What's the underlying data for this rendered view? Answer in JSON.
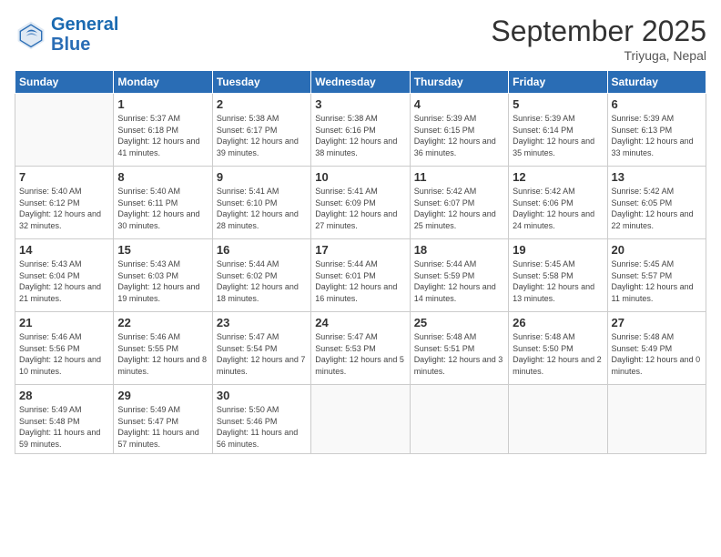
{
  "header": {
    "logo_text_general": "General",
    "logo_text_blue": "Blue",
    "month_title": "September 2025",
    "location": "Triyuga, Nepal"
  },
  "days_of_week": [
    "Sunday",
    "Monday",
    "Tuesday",
    "Wednesday",
    "Thursday",
    "Friday",
    "Saturday"
  ],
  "weeks": [
    [
      {
        "day": "",
        "sunrise": "",
        "sunset": "",
        "daylight": ""
      },
      {
        "day": "1",
        "sunrise": "Sunrise: 5:37 AM",
        "sunset": "Sunset: 6:18 PM",
        "daylight": "Daylight: 12 hours and 41 minutes."
      },
      {
        "day": "2",
        "sunrise": "Sunrise: 5:38 AM",
        "sunset": "Sunset: 6:17 PM",
        "daylight": "Daylight: 12 hours and 39 minutes."
      },
      {
        "day": "3",
        "sunrise": "Sunrise: 5:38 AM",
        "sunset": "Sunset: 6:16 PM",
        "daylight": "Daylight: 12 hours and 38 minutes."
      },
      {
        "day": "4",
        "sunrise": "Sunrise: 5:39 AM",
        "sunset": "Sunset: 6:15 PM",
        "daylight": "Daylight: 12 hours and 36 minutes."
      },
      {
        "day": "5",
        "sunrise": "Sunrise: 5:39 AM",
        "sunset": "Sunset: 6:14 PM",
        "daylight": "Daylight: 12 hours and 35 minutes."
      },
      {
        "day": "6",
        "sunrise": "Sunrise: 5:39 AM",
        "sunset": "Sunset: 6:13 PM",
        "daylight": "Daylight: 12 hours and 33 minutes."
      }
    ],
    [
      {
        "day": "7",
        "sunrise": "Sunrise: 5:40 AM",
        "sunset": "Sunset: 6:12 PM",
        "daylight": "Daylight: 12 hours and 32 minutes."
      },
      {
        "day": "8",
        "sunrise": "Sunrise: 5:40 AM",
        "sunset": "Sunset: 6:11 PM",
        "daylight": "Daylight: 12 hours and 30 minutes."
      },
      {
        "day": "9",
        "sunrise": "Sunrise: 5:41 AM",
        "sunset": "Sunset: 6:10 PM",
        "daylight": "Daylight: 12 hours and 28 minutes."
      },
      {
        "day": "10",
        "sunrise": "Sunrise: 5:41 AM",
        "sunset": "Sunset: 6:09 PM",
        "daylight": "Daylight: 12 hours and 27 minutes."
      },
      {
        "day": "11",
        "sunrise": "Sunrise: 5:42 AM",
        "sunset": "Sunset: 6:07 PM",
        "daylight": "Daylight: 12 hours and 25 minutes."
      },
      {
        "day": "12",
        "sunrise": "Sunrise: 5:42 AM",
        "sunset": "Sunset: 6:06 PM",
        "daylight": "Daylight: 12 hours and 24 minutes."
      },
      {
        "day": "13",
        "sunrise": "Sunrise: 5:42 AM",
        "sunset": "Sunset: 6:05 PM",
        "daylight": "Daylight: 12 hours and 22 minutes."
      }
    ],
    [
      {
        "day": "14",
        "sunrise": "Sunrise: 5:43 AM",
        "sunset": "Sunset: 6:04 PM",
        "daylight": "Daylight: 12 hours and 21 minutes."
      },
      {
        "day": "15",
        "sunrise": "Sunrise: 5:43 AM",
        "sunset": "Sunset: 6:03 PM",
        "daylight": "Daylight: 12 hours and 19 minutes."
      },
      {
        "day": "16",
        "sunrise": "Sunrise: 5:44 AM",
        "sunset": "Sunset: 6:02 PM",
        "daylight": "Daylight: 12 hours and 18 minutes."
      },
      {
        "day": "17",
        "sunrise": "Sunrise: 5:44 AM",
        "sunset": "Sunset: 6:01 PM",
        "daylight": "Daylight: 12 hours and 16 minutes."
      },
      {
        "day": "18",
        "sunrise": "Sunrise: 5:44 AM",
        "sunset": "Sunset: 5:59 PM",
        "daylight": "Daylight: 12 hours and 14 minutes."
      },
      {
        "day": "19",
        "sunrise": "Sunrise: 5:45 AM",
        "sunset": "Sunset: 5:58 PM",
        "daylight": "Daylight: 12 hours and 13 minutes."
      },
      {
        "day": "20",
        "sunrise": "Sunrise: 5:45 AM",
        "sunset": "Sunset: 5:57 PM",
        "daylight": "Daylight: 12 hours and 11 minutes."
      }
    ],
    [
      {
        "day": "21",
        "sunrise": "Sunrise: 5:46 AM",
        "sunset": "Sunset: 5:56 PM",
        "daylight": "Daylight: 12 hours and 10 minutes."
      },
      {
        "day": "22",
        "sunrise": "Sunrise: 5:46 AM",
        "sunset": "Sunset: 5:55 PM",
        "daylight": "Daylight: 12 hours and 8 minutes."
      },
      {
        "day": "23",
        "sunrise": "Sunrise: 5:47 AM",
        "sunset": "Sunset: 5:54 PM",
        "daylight": "Daylight: 12 hours and 7 minutes."
      },
      {
        "day": "24",
        "sunrise": "Sunrise: 5:47 AM",
        "sunset": "Sunset: 5:53 PM",
        "daylight": "Daylight: 12 hours and 5 minutes."
      },
      {
        "day": "25",
        "sunrise": "Sunrise: 5:48 AM",
        "sunset": "Sunset: 5:51 PM",
        "daylight": "Daylight: 12 hours and 3 minutes."
      },
      {
        "day": "26",
        "sunrise": "Sunrise: 5:48 AM",
        "sunset": "Sunset: 5:50 PM",
        "daylight": "Daylight: 12 hours and 2 minutes."
      },
      {
        "day": "27",
        "sunrise": "Sunrise: 5:48 AM",
        "sunset": "Sunset: 5:49 PM",
        "daylight": "Daylight: 12 hours and 0 minutes."
      }
    ],
    [
      {
        "day": "28",
        "sunrise": "Sunrise: 5:49 AM",
        "sunset": "Sunset: 5:48 PM",
        "daylight": "Daylight: 11 hours and 59 minutes."
      },
      {
        "day": "29",
        "sunrise": "Sunrise: 5:49 AM",
        "sunset": "Sunset: 5:47 PM",
        "daylight": "Daylight: 11 hours and 57 minutes."
      },
      {
        "day": "30",
        "sunrise": "Sunrise: 5:50 AM",
        "sunset": "Sunset: 5:46 PM",
        "daylight": "Daylight: 11 hours and 56 minutes."
      },
      {
        "day": "",
        "sunrise": "",
        "sunset": "",
        "daylight": ""
      },
      {
        "day": "",
        "sunrise": "",
        "sunset": "",
        "daylight": ""
      },
      {
        "day": "",
        "sunrise": "",
        "sunset": "",
        "daylight": ""
      },
      {
        "day": "",
        "sunrise": "",
        "sunset": "",
        "daylight": ""
      }
    ]
  ]
}
